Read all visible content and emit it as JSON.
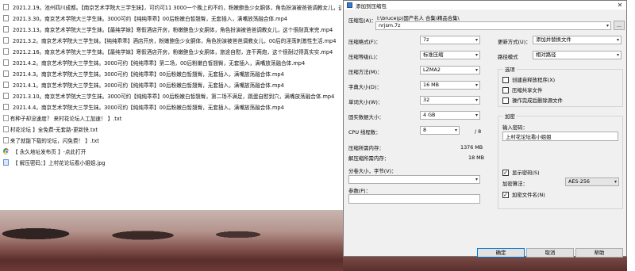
{
  "files": [
    {
      "name": "2021.2.19。池州四川成都。【南京艺术学院大三学生妹】，可约可11 3000一个晚上的不约，粉嫩鲍鱼少女胴体，角色扮演被爸爸调教女儿，这次",
      "type": "video"
    },
    {
      "name": "2021.3.30。南京艺术学院大三学生妹。3000可约【纯纯乖乖】00后粉嫩白皙翘臀，无套插入，满嘴放荡融合体.mp4",
      "type": "video"
    },
    {
      "name": "2021.3.13。南京艺术学院大三学生妹。【最纯学妹】寒假酒店开房，粉嫩鲍鱼少女胴体，角色扮演被爸爸调教女儿，这个很耐真来完.mp4",
      "type": "video"
    },
    {
      "name": "2021.3.2。南京艺术学院大三学生妹。【纯纯乖乖】酒店开房，粉嫩鲍鱼少女胴体，角色扮演被爸爸调教女儿，00后的淫荡刺激性生活.mp4",
      "type": "video"
    },
    {
      "name": "2021.2.16。南京艺术学院大三学生妹。【最纯学妹】寒假酒店开房，粉嫩鲍鱼少女胴体，旅途自慰，连干两炮，这个很耐过得真实实.mp4",
      "type": "video"
    },
    {
      "name": "2021.4.2。南京艺术学院大三学生妹。3000可约【纯纯乖乖】第二场，00后粉嫩白皙翘臀，无套插入，满嘴放荡融合体.mp4",
      "type": "video"
    },
    {
      "name": "2021.4.3。南京艺术学院大三学生妹。3000可约【纯纯乖乖】00后粉嫩白皙翘臀，无套插入，满嘴放荡融合体.mp4",
      "type": "video"
    },
    {
      "name": "2021.4.1。南京艺术学院大三学生妹。3000可约【纯纯乖乖】00后粉嫩白皙翘臀，无套插入，满嘴放荡融合体.mp4",
      "type": "video"
    },
    {
      "name": "2021.3.10。南京艺术学院大三学生妹。3000可约【纯纯乖乖】00后粉嫩白皙翘臀，第二场不满足，跳蛋自慰到穴，满嘴放荡融合体.mp4",
      "type": "video"
    },
    {
      "name": "2021.4.4。南京艺术学院大三学生妹。3000可约【纯纯乖乖】00后粉嫩白皙翘臀，无套插入，满嘴放荡融合体.mp4",
      "type": "video"
    },
    {
      "name": "【 有种子却没速度？ 来村花论坛人工加速！ 】.txt",
      "type": "txt"
    },
    {
      "name": "【 村花论坛 】全免费-无套路-更新快.txt",
      "type": "txt"
    },
    {
      "name": "【 来了就能下载的论坛，闪免费！ 】.txt",
      "type": "txt"
    },
    {
      "name": "【 永久地址发布页 】-点此打开",
      "type": "chrome"
    },
    {
      "name": "【 解压密码：】上村花论坛看小姐姐.jpg",
      "type": "jpg"
    }
  ],
  "dialog": {
    "title": "添加到压缩包",
    "close": "✕",
    "archive_label": "压缩包(A)：",
    "archive_path": "I:\\bruce(p)国产名人 合集\\精品合集\\",
    "archive_name": "nrjsm.7z",
    "browse_label": "...",
    "format_label": "压缩格式(F)：",
    "format_value": "7z",
    "level_label": "压缩等级(L)：",
    "level_value": "标准压缩",
    "method_label": "压缩方法(M)：",
    "method_value": "LZMA2",
    "dict_label": "字典大小(D)：",
    "dict_value": "16 MB",
    "word_label": "单词大小(W)：",
    "word_value": "32",
    "solid_label": "固实数据大小：",
    "solid_value": "4 GB",
    "cpu_label": "CPU 线程数：",
    "cpu_value": "8",
    "cpu_max": "/ 8",
    "mem_comp_label": "压缩所需内存：",
    "mem_comp_value": "1376 MB",
    "mem_decomp_label": "解压缩所需内存：",
    "mem_decomp_value": "18 MB",
    "split_label": "分卷大小，字节(V)：",
    "split_value": "",
    "params_label": "参数(P)：",
    "params_value": "",
    "update_label": "更新方式(U)：",
    "update_value": "添加并替换文件",
    "path_label": "路径模式",
    "path_value": "相对路径",
    "options_title": "选项",
    "opt_sfx": "创建自释放程序(X)",
    "opt_shared": "压缩共享文件",
    "opt_delete": "操作完成后删除源文件",
    "encrypt_title": "加密",
    "password_label": "输入密码：",
    "password_value": "上村花论坛看小姐姐",
    "show_password": "显示密码(S)",
    "enc_method_label": "加密算法：",
    "enc_method_value": "AES-256",
    "enc_names": "加密文件名(N)",
    "ok": "确定",
    "cancel": "取消",
    "help": "帮助"
  }
}
